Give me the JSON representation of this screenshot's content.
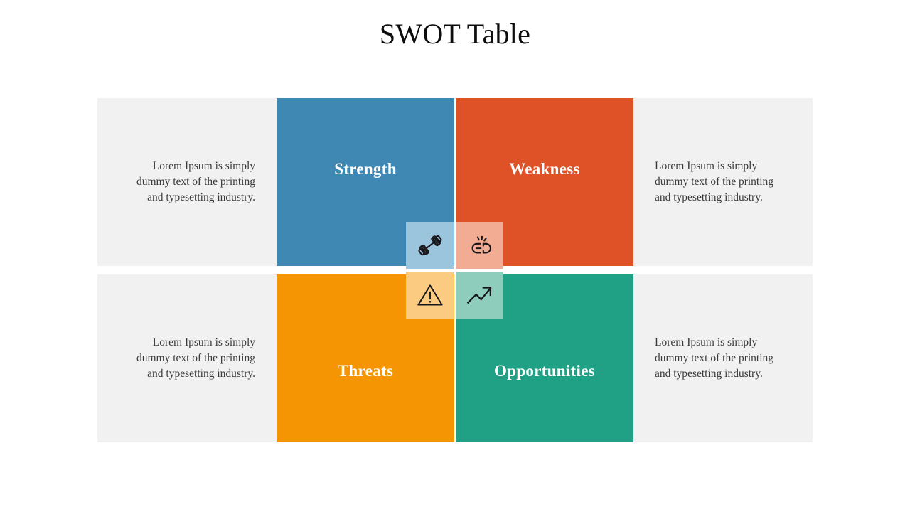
{
  "slide": {
    "title": "SWOT Table",
    "background_color": "#ffffff"
  },
  "palette": {
    "strength": "#3f88b3",
    "weakness": "#df5127",
    "threats": "#f59503",
    "opportunities": "#20a185",
    "panel_gray": "#f1f1f1",
    "strength_tile": "#9bc4dd",
    "weakness_tile": "#f2ac93",
    "threats_tile": "#fbcb81",
    "opportunities_tile": "#8ecdbc",
    "label_text": "#ffffff",
    "body_text": "#3a3a3a",
    "title_text": "#0d0d0d"
  },
  "table": {
    "rows": [
      {
        "row_name": "top-row",
        "left_panel": {
          "text": "Lorem Ipsum is simply dummy text of the printing and typesetting industry.",
          "align": "right"
        },
        "quadrants": [
          {
            "key": "strength",
            "label": "Strength",
            "color": "#3f88b3",
            "icon": "dumbbell-icon",
            "icon_tile_color": "#9bc4dd"
          },
          {
            "key": "weakness",
            "label": "Weakness",
            "color": "#df5127",
            "icon": "broken-chain-icon",
            "icon_tile_color": "#f2ac93"
          }
        ],
        "right_panel": {
          "text": "Lorem Ipsum is simply dummy text of the printing and typesetting industry.",
          "align": "left"
        }
      },
      {
        "row_name": "bottom-row",
        "left_panel": {
          "text": "Lorem Ipsum is simply dummy text of the printing and typesetting industry.",
          "align": "right"
        },
        "quadrants": [
          {
            "key": "threats",
            "label": "Threats",
            "color": "#f59503",
            "icon": "warning-triangle-icon",
            "icon_tile_color": "#fbcb81"
          },
          {
            "key": "opportunities",
            "label": "Opportunities",
            "color": "#20a185",
            "icon": "trend-up-arrow-icon",
            "icon_tile_color": "#8ecdbc"
          }
        ],
        "right_panel": {
          "text": "Lorem Ipsum is simply dummy text of the printing and typesetting industry.",
          "align": "left"
        }
      }
    ]
  }
}
